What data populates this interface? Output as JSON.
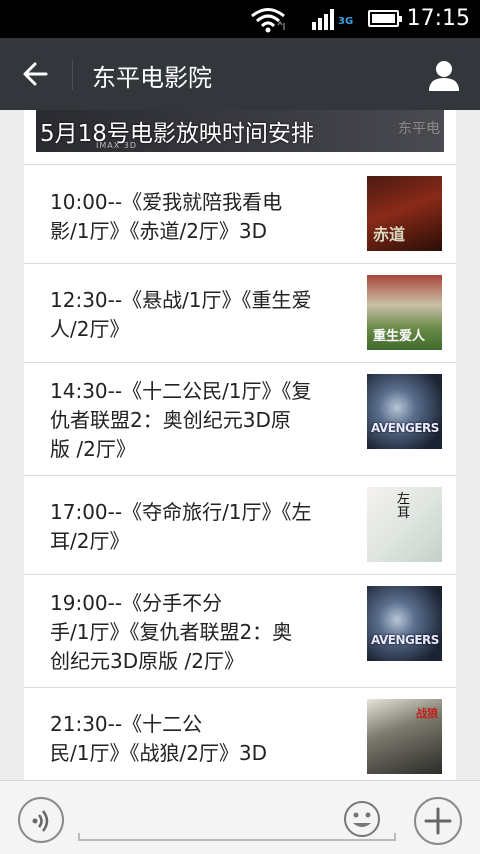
{
  "status_bar": {
    "time": "17:15",
    "network": "3G",
    "icons": [
      "wifi-icon",
      "signal-icon",
      "battery-icon"
    ]
  },
  "header": {
    "title": "东平电影院",
    "back_icon": "arrow-left-icon",
    "profile_icon": "user-icon",
    "background": "#33363b"
  },
  "banner": {
    "text": "5月18号电影放映时间安排",
    "watermark": "东平电",
    "strip": "IMAX 3D"
  },
  "schedule": [
    {
      "lines": [
        "10:00--《爱我就陪我看电",
        "影/1厅》《赤道/2厅》3D"
      ],
      "thumb_text": "赤道"
    },
    {
      "lines": [
        "12:30--《悬战/1厅》《重生爱",
        "人/2厅》"
      ],
      "thumb_text": "重生爱人"
    },
    {
      "lines": [
        "14:30--《十二公民/1厅》《复",
        "仇者联盟2：奥创纪元3D原",
        "版 /2厅》"
      ],
      "thumb_text": "AVENGERS"
    },
    {
      "lines": [
        "17:00--《夺命旅行/1厅》《左",
        "耳/2厅》"
      ],
      "thumb_text": "左耳"
    },
    {
      "lines": [
        "19:00--《分手不分",
        "手/1厅》《复仇者联盟2：奥",
        "创纪元3D原版 /2厅》"
      ],
      "thumb_text": "AVENGERS"
    },
    {
      "lines": [
        "21:30--《十二公",
        "民/1厅》《战狼/2厅》3D"
      ],
      "thumb_text": "战狼"
    }
  ],
  "bottom_bar": {
    "voice_icon": "voice-icon",
    "emoji_icon": "emoji-icon",
    "plus_icon": "plus-icon",
    "input_placeholder": ""
  }
}
